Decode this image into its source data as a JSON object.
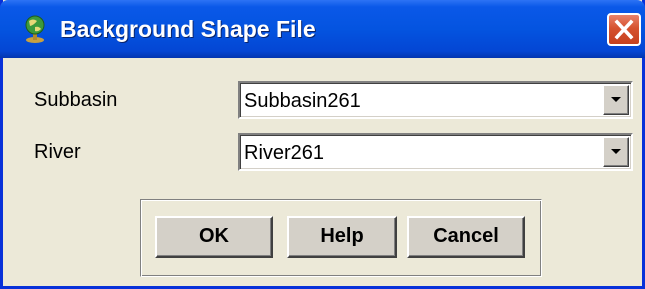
{
  "window": {
    "title": "Background Shape File",
    "icon": "globe-icon",
    "close_icon": "close-icon"
  },
  "form": {
    "subbasin": {
      "label": "Subbasin",
      "value": "Subbasin261"
    },
    "river": {
      "label": "River",
      "value": "River261"
    }
  },
  "buttons": {
    "ok": "OK",
    "help": "Help",
    "cancel": "Cancel"
  },
  "colors": {
    "title_bar": "#0454E0",
    "close_button": "#D6522F",
    "dialog_background": "#ECE9D8",
    "button_face": "#D4D0C8"
  }
}
